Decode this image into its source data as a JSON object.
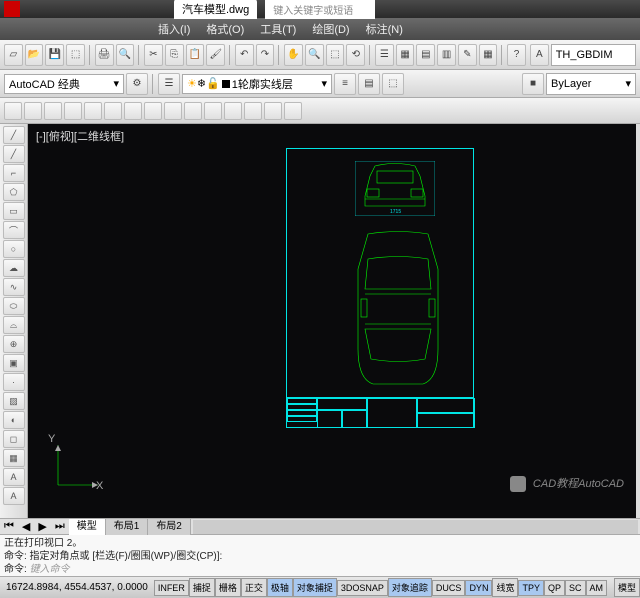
{
  "titlebar": {
    "filename": "汽车模型.dwg",
    "search_placeholder": "键入关键字或短语"
  },
  "menu": {
    "insert": "插入(I)",
    "format": "格式(O)",
    "tools": "工具(T)",
    "draw": "绘图(D)",
    "annotate": "标注(N)"
  },
  "style": {
    "dim_style": "TH_GBDIM"
  },
  "workspace": {
    "name": "AutoCAD 经典"
  },
  "layer": {
    "current": "1轮廓实线层",
    "bylayer": "ByLayer"
  },
  "viewport": {
    "label": "[-][俯视][二维线框]"
  },
  "ucs": {
    "x": "X",
    "y": "Y"
  },
  "layout_tabs": {
    "model": "模型",
    "layout1": "布局1",
    "layout2": "布局2"
  },
  "cmdline": {
    "line1": "正在打印视口 2。",
    "line2": "命令: 指定对角点或 [栏选(F)/圈围(WP)/圈交(CP)]:",
    "prompt": "命令:",
    "input": "键入命令"
  },
  "status": {
    "coords": "16724.8984, 4554.4537, 0.0000",
    "infer": "INFER",
    "snap": "捕捉",
    "grid": "栅格",
    "ortho": "正交",
    "polar": "极轴",
    "osnap": "对象捕捉",
    "osnap3d": "3DOSNAP",
    "otrack": "对象追踪",
    "ducs": "DUCS",
    "dyn": "DYN",
    "lwt": "线宽",
    "tpy": "TPY",
    "qp": "QP",
    "sc": "SC",
    "am": "AM",
    "ms": "模型"
  },
  "chart_data": {
    "type": "drawing",
    "title": "汽车模型",
    "views": [
      "front",
      "top"
    ],
    "dim_label_front": "1715"
  },
  "watermark": {
    "text": "CAD教程AutoCAD"
  }
}
